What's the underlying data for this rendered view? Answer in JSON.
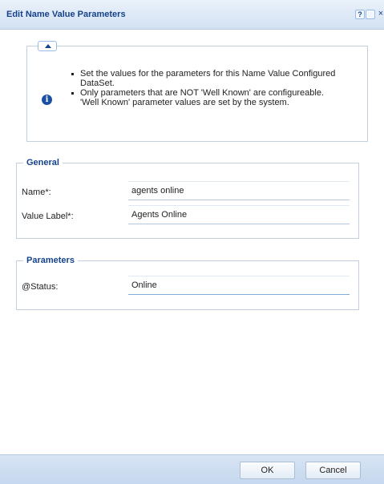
{
  "window": {
    "title": "Edit Name Value Parameters",
    "help_label": "?",
    "close_label": "×"
  },
  "info": {
    "icon": "info-icon",
    "bullets": [
      "Set the values for the parameters for this Name Value Configured DataSet.",
      "Only parameters that are NOT 'Well Known' are configureable. 'Well Known' parameter values are set by the system."
    ]
  },
  "general": {
    "legend": "General",
    "name_label": "Name*:",
    "name_value": "agents online",
    "value_label_label": "Value Label*:",
    "value_label_value": "Agents Online"
  },
  "parameters": {
    "legend": "Parameters",
    "status_label": "@Status:",
    "status_value": "Online"
  },
  "buttons": {
    "ok": "OK",
    "cancel": "Cancel"
  },
  "colors": {
    "title_text": "#15428b",
    "titlebar_bg": "#dfe8f6",
    "footer_bg": "#cfdff2",
    "border": "#c3cfdc"
  }
}
